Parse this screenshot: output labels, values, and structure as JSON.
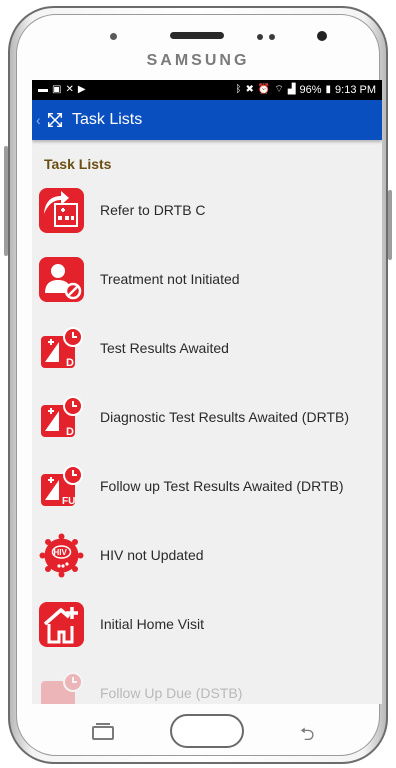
{
  "device": {
    "brand": "SAMSUNG"
  },
  "status_bar": {
    "left_icons": [
      "chat-notification-icon",
      "image-notification-icon",
      "app-notification-icon",
      "play-notification-icon"
    ],
    "right_icons": [
      "bluetooth-icon",
      "mute-icon",
      "alarm-icon",
      "wifi-icon",
      "signal-icon",
      "battery-icon"
    ],
    "battery": "96%",
    "time": "9:13 PM"
  },
  "app_bar": {
    "title": "Task Lists"
  },
  "section_title": "Task Lists",
  "tasks": [
    {
      "label": "Refer to DRTB C",
      "icon": "refer-hospital-icon"
    },
    {
      "label": "Treatment not Initiated",
      "icon": "user-blocked-icon"
    },
    {
      "label": "Test Results Awaited",
      "icon": "test-clock-d-icon",
      "badge": "D"
    },
    {
      "label": "Diagnostic Test Results Awaited (DRTB)",
      "icon": "test-clock-d-icon",
      "badge": "D"
    },
    {
      "label": "Follow up Test Results Awaited (DRTB)",
      "icon": "test-clock-fu-icon",
      "badge": "FU"
    },
    {
      "label": "HIV not Updated",
      "icon": "hiv-icon",
      "badge": "HIV"
    },
    {
      "label": "Initial Home Visit",
      "icon": "home-add-icon"
    },
    {
      "label": "Follow Up Due (DSTB)",
      "icon": "test-clock-icon"
    }
  ],
  "colors": {
    "accent": "#0a4fbf",
    "icon_red": "#e3222b",
    "section_title": "#6b4e12"
  }
}
